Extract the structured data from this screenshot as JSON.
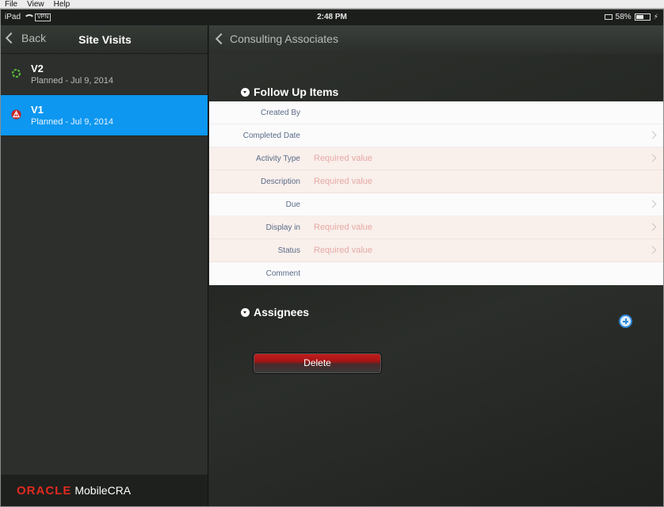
{
  "menu": [
    "File",
    "View",
    "Help"
  ],
  "status_bar": {
    "carrier": "iPad",
    "vpn": "VPN",
    "time": "2:48 PM",
    "battery": "58%",
    "battery_level": 0.58
  },
  "left_pane": {
    "back_label": "Back",
    "title": "Site Visits",
    "visits": [
      {
        "name": "V2",
        "subtitle": "Planned - Jul 9, 2014",
        "status_icon": "loading-icon",
        "selected": false
      },
      {
        "name": "V1",
        "subtitle": "Planned - Jul 9, 2014",
        "status_icon": "warning-icon",
        "selected": true
      }
    ],
    "footer": {
      "brand": "ORACLE",
      "product": "MobileCRA"
    }
  },
  "right_pane": {
    "back_label": "Consulting Associates",
    "follow_up": {
      "title": "Follow Up Items",
      "fields": [
        {
          "label": "Created By",
          "value": "",
          "required": false,
          "arrow": false
        },
        {
          "label": "Completed Date",
          "value": "",
          "required": false,
          "arrow": true
        },
        {
          "label": "Activity Type",
          "value": "Required value",
          "required": true,
          "arrow": true
        },
        {
          "label": "Description",
          "value": "Required value",
          "required": true,
          "arrow": false
        },
        {
          "label": "Due",
          "value": "",
          "required": false,
          "arrow": true
        },
        {
          "label": "Display in",
          "value": "Required value",
          "required": true,
          "arrow": true
        },
        {
          "label": "Status",
          "value": "Required value",
          "required": true,
          "arrow": true
        },
        {
          "label": "Comment",
          "value": "",
          "required": false,
          "arrow": false
        }
      ]
    },
    "assignees": {
      "title": "Assignees"
    },
    "delete_label": "Delete"
  },
  "colors": {
    "selection": "#0d97f0",
    "required_bg": "#f9efeb",
    "required_text": "#e6aaa5",
    "brand_red": "#e02a1f",
    "delete_red": "#c41e1e"
  }
}
